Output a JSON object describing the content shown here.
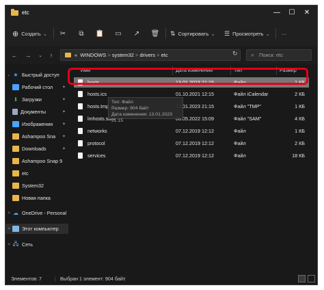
{
  "window": {
    "title": "etc",
    "minimize": "—",
    "maximize": "☐",
    "close": "✕"
  },
  "toolbar": {
    "create_label": "Создать",
    "sort_label": "Сортировать",
    "view_label": "Просмотреть",
    "more_label": "···"
  },
  "navigation": {
    "back": "←",
    "forward": "→",
    "dropdown": "⌄",
    "up": "↑",
    "breadcrumb_prefix": "«",
    "breadcrumb": [
      "WINDOWS",
      "system32",
      "drivers",
      "etc"
    ],
    "breadcrumb_sep": ">",
    "refresh": "↻",
    "search_placeholder": "Поиск: etc"
  },
  "sidebar": {
    "items": [
      {
        "label": "Быстрый доступ",
        "icon": "star-icon",
        "color": "#4aa3ff",
        "chev": "⌄",
        "level": 0
      },
      {
        "label": "Рабочий стол",
        "icon": "desktop-icon",
        "color": "#4aa3ff",
        "pin": "📌",
        "level": 1
      },
      {
        "label": "Загрузки",
        "icon": "downloads-icon",
        "color": "#39b26f",
        "pin": "📌",
        "level": 1
      },
      {
        "label": "Документы",
        "icon": "documents-icon",
        "color": "#9aa8c5",
        "pin": "📌",
        "level": 1
      },
      {
        "label": "Изображения",
        "icon": "pictures-icon",
        "color": "#4aa3ff",
        "pin": "📌",
        "level": 1
      },
      {
        "label": "Ashampoo Sna",
        "icon": "folder-icon",
        "color": "#e8b64c",
        "pin": "📌",
        "level": 1
      },
      {
        "label": "Downloads",
        "icon": "folder-icon",
        "color": "#e8b64c",
        "pin": "📌",
        "level": 1
      },
      {
        "label": "Ashampoo Snap 9",
        "icon": "folder-icon",
        "color": "#e8b64c",
        "level": 1
      },
      {
        "label": "etc",
        "icon": "folder-icon",
        "color": "#e8b64c",
        "level": 1
      },
      {
        "label": "System32",
        "icon": "folder-icon",
        "color": "#e8b64c",
        "level": 1
      },
      {
        "label": "Новая папка",
        "icon": "folder-icon",
        "color": "#e8b64c",
        "level": 1
      },
      {
        "label": "OneDrive - Personal",
        "icon": "onedrive-icon",
        "color": "#4aa3ff",
        "chev": ">",
        "level": 0
      },
      {
        "label": "Этот компьютер",
        "icon": "computer-icon",
        "color": "#7fb7e8",
        "chev": ">",
        "level": 0
      },
      {
        "label": "Сеть",
        "icon": "network-icon",
        "color": "#7fb7e8",
        "chev": ">",
        "level": 0
      }
    ]
  },
  "columns": {
    "name": "Имя",
    "date": "Дата изменения",
    "type": "Тип",
    "size": "Размер"
  },
  "files": [
    {
      "name": "hosts",
      "date": "13.01.2023 21:15",
      "type": "Файл",
      "size": "1 КБ"
    },
    {
      "name": "hosts.ics",
      "date": "01.10.2021 12:15",
      "type": "Файл iCalendar",
      "size": "2 КБ"
    },
    {
      "name": "hosts.tmp",
      "date": "13.01.2023 21:15",
      "type": "Файл \"TMP\"",
      "size": "1 КБ"
    },
    {
      "name": "lmhosts.sam",
      "date": "06.05.2022 15:09",
      "type": "Файл \"SAM\"",
      "size": "4 КБ"
    },
    {
      "name": "networks",
      "date": "07.12.2019 12:12",
      "type": "Файл",
      "size": "1 КБ"
    },
    {
      "name": "protocol",
      "date": "07.12.2019 12:12",
      "type": "Файл",
      "size": "2 КБ"
    },
    {
      "name": "services",
      "date": "07.12.2019 12:12",
      "type": "Файл",
      "size": "18 КБ"
    }
  ],
  "tooltip": {
    "line1": "Тип: Файл",
    "line2": "Размер: 904 байт",
    "line3": "Дата изменения: 13.01.2023 21:15"
  },
  "status": {
    "items_count": "Элементов: 7",
    "selected": "Выбран 1 элемент: 904 байт"
  },
  "colors": {
    "selection": "#777777",
    "highlight": "#e3001b",
    "folder": "#e8b64c"
  }
}
